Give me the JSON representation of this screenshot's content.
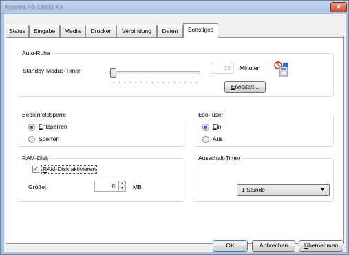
{
  "window": {
    "title": "Kyocera FS-1300D KX",
    "close_glyph": "✕"
  },
  "tabs": [
    {
      "label": "Status"
    },
    {
      "label": "Eingabe"
    },
    {
      "label": "Media"
    },
    {
      "label": "Drucker"
    },
    {
      "label": "Verbindung"
    },
    {
      "label": "Daten"
    },
    {
      "label": "Sonstiges"
    }
  ],
  "active_tab": "Sonstiges",
  "auto_ruhe": {
    "title": "Auto-Ruhe",
    "timer_label": "Standby-Modus-Timer",
    "minutes_value": "15",
    "minutes_unit_mnemonic": "M",
    "minutes_unit_rest": "inuten",
    "advanced_button_mnemonic": "E",
    "advanced_button_rest": "rweitert...",
    "icon": "power-timer-icon",
    "slider_level": 0.03
  },
  "bedienfeldsperre": {
    "title": "Bedienfeldsperre",
    "option_unlock_mnemonic": "E",
    "option_unlock_rest": "ntsperren",
    "option_lock_mnemonic": "S",
    "option_lock_rest": "perren",
    "selected": "Entsperren"
  },
  "ecofuser": {
    "title": "EcoFuser",
    "option_on_mnemonic": "E",
    "option_on_rest": "in",
    "option_off_mnemonic": "A",
    "option_off_rest": "us",
    "selected": "Ein"
  },
  "ram_disk": {
    "title": "RAM-Disk",
    "enable_mnemonic": "R",
    "enable_rest": "AM-Disk aktivieren",
    "enabled": true,
    "size_label_mnemonic": "G",
    "size_label_rest": "röße:",
    "size_value": "8",
    "size_unit": "MB"
  },
  "ausschalt_timer": {
    "title": "Ausschalt-Timer",
    "selected": "1 Stunde"
  },
  "footer": {
    "ok_label": "OK",
    "cancel_label": "Abbrechen",
    "apply_mnemonic": "Ü",
    "apply_rest": "bernehmen"
  },
  "colors": {
    "accent": "#1d5bbf",
    "frame": "#a9c3e0",
    "close": "#c84b31"
  }
}
